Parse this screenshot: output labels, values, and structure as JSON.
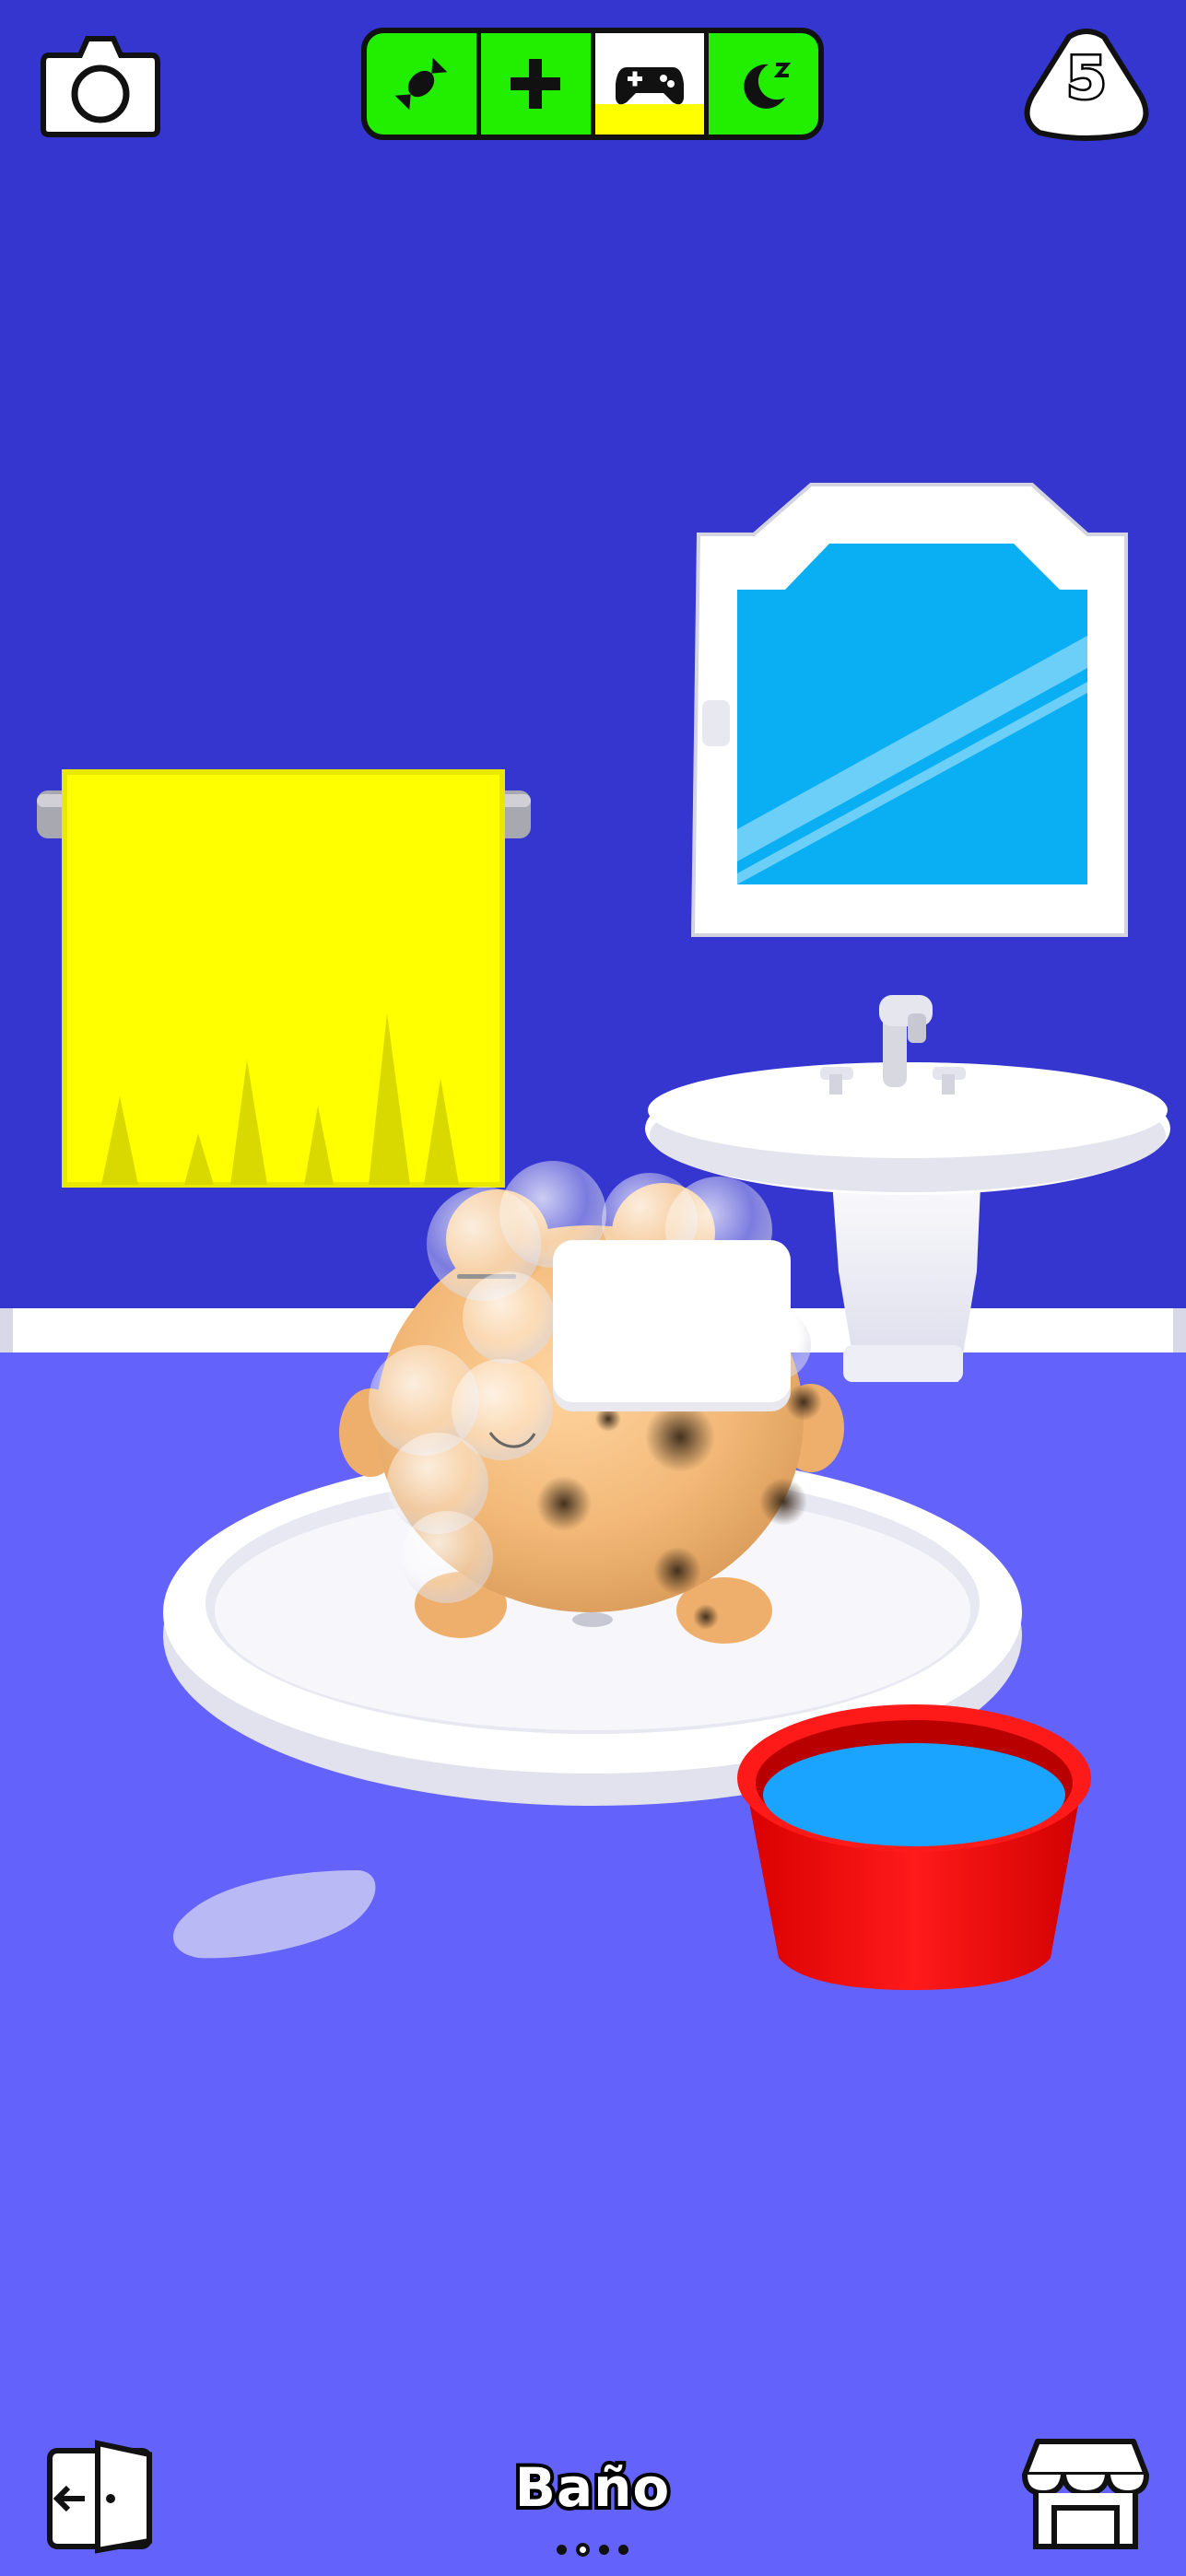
{
  "room": {
    "name": "Baño",
    "page_count": 4,
    "active_page": 1
  },
  "level": {
    "value": "5"
  },
  "needs": [
    {
      "name": "food",
      "icon": "candy-icon",
      "level": 1.0
    },
    {
      "name": "health",
      "icon": "plus-icon",
      "level": 1.0
    },
    {
      "name": "fun",
      "icon": "gamepad-icon",
      "level": 0.3
    },
    {
      "name": "energy",
      "icon": "moon-sleep-icon",
      "level": 1.0
    }
  ],
  "buttons": {
    "camera": "camera-icon",
    "exit": "exit-door-icon",
    "shop": "shop-icon"
  },
  "colors": {
    "wall": "#3535cf",
    "floor": "#6363fb",
    "need_full": "#22ee00",
    "need_warn": "#ffff00",
    "towel": "#ffff00",
    "bucket": "#ff0000",
    "water": "#1aa4ff",
    "mirror": "#0aaef2",
    "pet_skin": "#f2b877"
  }
}
